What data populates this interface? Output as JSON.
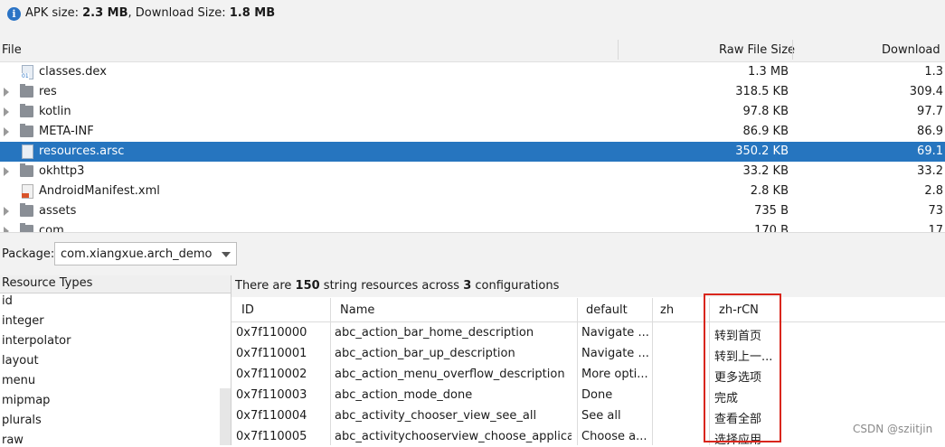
{
  "info": {
    "apk_label": "APK size: ",
    "apk_value": "2.3 MB",
    "sep": ", Download Size: ",
    "dl_value": "1.8 MB"
  },
  "tree": {
    "columns": [
      "File",
      "Raw File Size",
      "Download"
    ],
    "rows": [
      {
        "name": "classes.dex",
        "raw": "1.3 MB",
        "dl": "1.3",
        "icon": "dex-file-icon",
        "expandable": false,
        "selected": false
      },
      {
        "name": "res",
        "raw": "318.5 KB",
        "dl": "309.4",
        "icon": "folder-icon",
        "expandable": true,
        "selected": false
      },
      {
        "name": "kotlin",
        "raw": "97.8 KB",
        "dl": "97.7",
        "icon": "folder-icon",
        "expandable": true,
        "selected": false
      },
      {
        "name": "META-INF",
        "raw": "86.9 KB",
        "dl": "86.9",
        "icon": "folder-icon",
        "expandable": true,
        "selected": false
      },
      {
        "name": "resources.arsc",
        "raw": "350.2 KB",
        "dl": "69.1",
        "icon": "file-icon",
        "expandable": false,
        "selected": true
      },
      {
        "name": "okhttp3",
        "raw": "33.2 KB",
        "dl": "33.2",
        "icon": "folder-icon",
        "expandable": true,
        "selected": false
      },
      {
        "name": "AndroidManifest.xml",
        "raw": "2.8 KB",
        "dl": "2.8",
        "icon": "xml-file-icon",
        "expandable": false,
        "selected": false
      },
      {
        "name": "assets",
        "raw": "735 B",
        "dl": "73",
        "icon": "folder-icon",
        "expandable": true,
        "selected": false
      },
      {
        "name": "com",
        "raw": "170 B",
        "dl": "17",
        "icon": "folder-icon",
        "expandable": true,
        "selected": false
      }
    ]
  },
  "package": {
    "label": "Package:",
    "value": "com.xiangxue.arch_demo"
  },
  "resource_types": {
    "title": "Resource Types",
    "items": [
      "id",
      "integer",
      "interpolator",
      "layout",
      "menu",
      "mipmap",
      "plurals",
      "raw"
    ]
  },
  "strings": {
    "summary_prefix": "There are ",
    "count": "150",
    "summary_mid": " string resources across ",
    "configs": "3",
    "summary_suffix": " configurations",
    "columns": [
      "ID",
      "Name",
      "default",
      "zh",
      "zh-rCN"
    ],
    "rows": [
      {
        "id": "0x7f110000",
        "name": "abc_action_bar_home_description",
        "default": "Navigate ...",
        "zh": "",
        "zhrcn": "转到首页"
      },
      {
        "id": "0x7f110001",
        "name": "abc_action_bar_up_description",
        "default": "Navigate ...",
        "zh": "",
        "zhrcn": "转到上一..."
      },
      {
        "id": "0x7f110002",
        "name": "abc_action_menu_overflow_description",
        "default": "More opti...",
        "zh": "",
        "zhrcn": "更多选项"
      },
      {
        "id": "0x7f110003",
        "name": "abc_action_mode_done",
        "default": "Done",
        "zh": "",
        "zhrcn": "完成"
      },
      {
        "id": "0x7f110004",
        "name": "abc_activity_chooser_view_see_all",
        "default": "See all",
        "zh": "",
        "zhrcn": "查看全部"
      },
      {
        "id": "0x7f110005",
        "name": "abc_activitychooserview_choose_applica...",
        "default": "Choose a...",
        "zh": "",
        "zhrcn": "选择应用"
      }
    ]
  },
  "watermark": "CSDN @sziitjin",
  "colors": {
    "selection": "#2675bf",
    "highlight_box": "#d9261c",
    "info_icon": "#2a73c5"
  }
}
